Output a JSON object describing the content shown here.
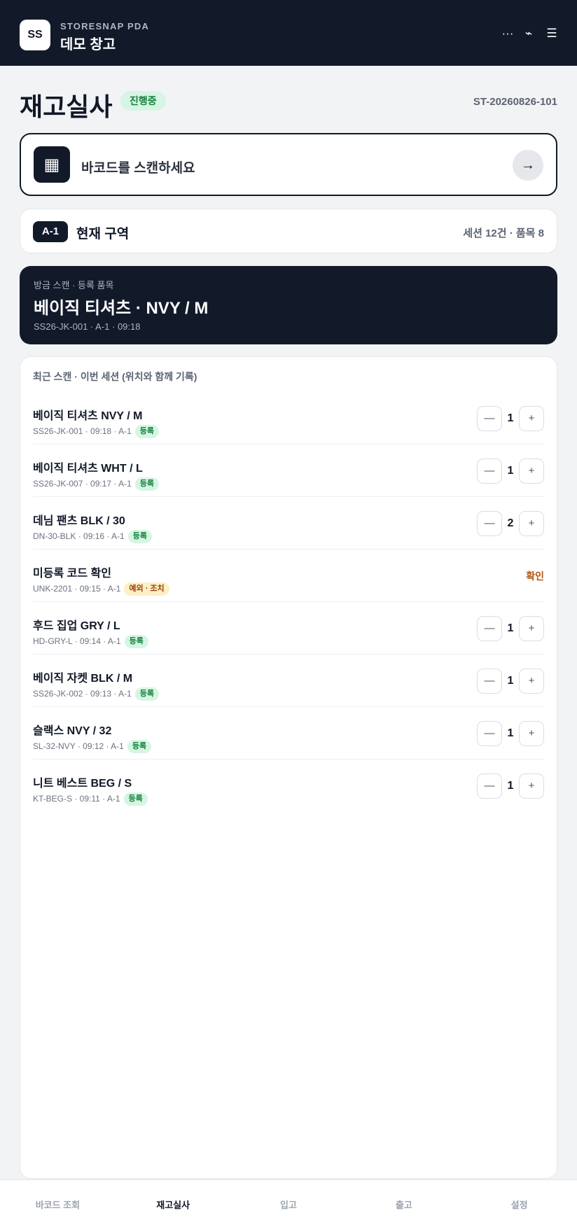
{
  "header": {
    "logo_text": "SS",
    "app_subtitle": "STORESNAP PDA",
    "warehouse_name": "데모 창고",
    "icons": [
      "more-icon",
      "signal-icon",
      "menu-icon"
    ],
    "icon_glyphs": [
      "···",
      "⌁",
      "☰"
    ]
  },
  "page": {
    "title": "재고실사",
    "status": "진행중",
    "session_id": "ST-20260826-101"
  },
  "scan": {
    "icon": "barcode-icon",
    "icon_glyph": "▦",
    "placeholder": "바코드를 스캔하세요",
    "submit_glyph": "→"
  },
  "zone": {
    "code": "A-1",
    "label": "현재 구역",
    "stats": "세션 12건 · 품목 8"
  },
  "last_scan": {
    "caption": "방금 스캔 · 등록 품목",
    "title": "베이직 티셔츠 · NVY / M",
    "meta": "SS26-JK-001 · A-1 · 09:18"
  },
  "recent": {
    "heading": "최근 스캔 · 이번 세션 (위치와 함께 기록)",
    "items": [
      {
        "name": "베이직 티셔츠 NVY / M",
        "meta": "SS26-JK-001 · 09:18 · A-1",
        "tag": "등록",
        "qty": "1"
      },
      {
        "name": "베이직 티셔츠 WHT / L",
        "meta": "SS26-JK-007 · 09:17 · A-1",
        "tag": "등록",
        "qty": "1"
      },
      {
        "name": "데님 팬츠 BLK / 30",
        "meta": "DN-30-BLK · 09:16 · A-1",
        "tag": "등록",
        "qty": "2"
      },
      {
        "name": "미등록 코드 확인",
        "meta": "UNK-2201 · 09:15 · A-1",
        "tag": "예외 · 조치",
        "action": "확인"
      },
      {
        "name": "후드 집업 GRY / L",
        "meta": "HD-GRY-L · 09:14 · A-1",
        "tag": "등록",
        "qty": "1"
      },
      {
        "name": "베이직 자켓 BLK / M",
        "meta": "SS26-JK-002 · 09:13 · A-1",
        "tag": "등록",
        "qty": "1"
      },
      {
        "name": "슬랙스 NVY / 32",
        "meta": "SL-32-NVY · 09:12 · A-1",
        "tag": "등록",
        "qty": "1"
      },
      {
        "name": "니트 베스트 BEG / S",
        "meta": "KT-BEG-S · 09:11 · A-1",
        "tag": "등록",
        "qty": "1"
      }
    ],
    "minus_glyph": "—",
    "plus_glyph": "+"
  },
  "nav": {
    "items": [
      "바코드 조회",
      "재고실사",
      "입고",
      "출고",
      "설정"
    ],
    "active": "재고실사"
  },
  "colors": {
    "header_bg": "#121a2a",
    "accent_green": "#15803d",
    "warning_amber": "#b45309"
  }
}
